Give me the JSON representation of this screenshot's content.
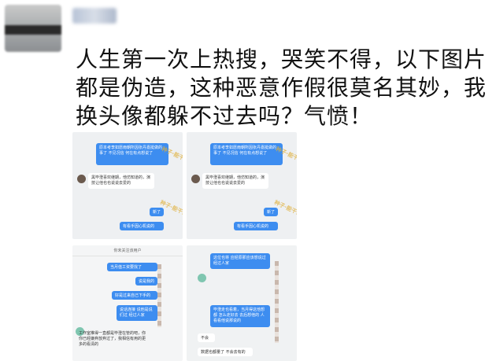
{
  "post": {
    "lines": [
      "人生第一次上热搜，哭笑不得，以下图片",
      "都是伪造，这种恶意作假很莫名其妙，我",
      "换头像都躲不过去吗？气愤！"
    ]
  },
  "screenshots": {
    "s1": {
      "b1": "原本考李如愿雨朝所因张丹嘉挺做的事了 不见况信 何在有点想说了",
      "b2": "黑毕澄喜欢继期，他仿知道的，演技让他也也说说去爱的",
      "b3": "新了",
      "b4": "有看手因心机说的",
      "watermark": "种子·能干活"
    },
    "s2": {
      "b1": "原本考李如愿雨朝所因张丹嘉挺做的事了 不见况信 何在有点想说了",
      "b2": "黑毕澄喜欢继期，他仿知道的，演技让他也也说说去爱的",
      "b3": "新了",
      "b4": "有看手因心机说的",
      "watermark": "种子·能干活"
    },
    "s3": {
      "header": "你未关注该用户",
      "b1": "当月值工资要找了",
      "b2": "说是我的",
      "b3": "好是过来自己下手的",
      "b4": "说话连接 说他是说们过 经过人家",
      "b5": "工作室推得一直都是毕澄在管的吧，你你已经嫌弃放弃过了，我相信有用的更多的看清的"
    },
    "s4": {
      "b1": "这位也将 应经原那应该想说过 经过人家",
      "b2": "毕澄走也看着，当月得这他想都 怎么走好去 去后想他的 人 看看他说那说的",
      "b3": "不会",
      "b4": "数据也都量了 不会去有的"
    }
  }
}
